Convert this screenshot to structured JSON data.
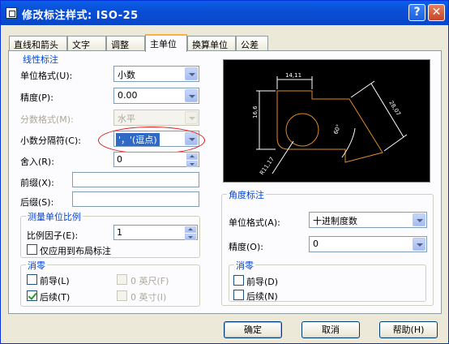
{
  "window": {
    "title": "修改标注样式: ISO-25",
    "help_button": "?",
    "close_button": "✕"
  },
  "tabs": [
    {
      "label": "直线和箭头",
      "active": false
    },
    {
      "label": "文字",
      "active": false
    },
    {
      "label": "调整",
      "active": false
    },
    {
      "label": "主单位",
      "active": true
    },
    {
      "label": "换算单位",
      "active": false
    },
    {
      "label": "公差",
      "active": false
    }
  ],
  "linear": {
    "title": "线性标注",
    "unit_format_label": "单位格式(U):",
    "unit_format_value": "小数",
    "precision_label": "精度(P):",
    "precision_value": "0.00",
    "fraction_label": "分数格式(M):",
    "fraction_value": "水平",
    "decimal_sep_label": "小数分隔符(C):",
    "decimal_sep_value": "'，'(逗点)",
    "round_label": "舍入(R):",
    "round_value": "0",
    "prefix_label": "前缀(X):",
    "prefix_value": "",
    "suffix_label": "后缀(S):",
    "suffix_value": ""
  },
  "scale": {
    "title": "测量单位比例",
    "factor_label": "比例因子(E):",
    "factor_value": "1",
    "layout_only_label": "仅应用到布局标注",
    "layout_only_checked": false
  },
  "zero_linear": {
    "title": "消零",
    "leading_label": "前导(L)",
    "leading_checked": false,
    "trailing_label": "后续(T)",
    "trailing_checked": true,
    "feet_label": "0 英尺(F)",
    "inches_label": "0 英寸(I)"
  },
  "angular": {
    "title": "角度标注",
    "unit_format_label": "单位格式(A):",
    "unit_format_value": "十进制度数",
    "precision_label": "精度(O):",
    "precision_value": "0"
  },
  "zero_angular": {
    "title": "消零",
    "leading_label": "前导(D)",
    "leading_checked": false,
    "trailing_label": "后续(N)",
    "trailing_checked": false
  },
  "preview": {
    "dim_top": "14,11",
    "dim_left": "16,6",
    "dim_right": "28,07",
    "dim_angle": "60°",
    "dim_radius": "R11,17",
    "line_color": "#ffffff",
    "geometry_color": "#e08a28"
  },
  "buttons": {
    "ok": "确定",
    "cancel": "取消",
    "help": "帮助(H)"
  }
}
